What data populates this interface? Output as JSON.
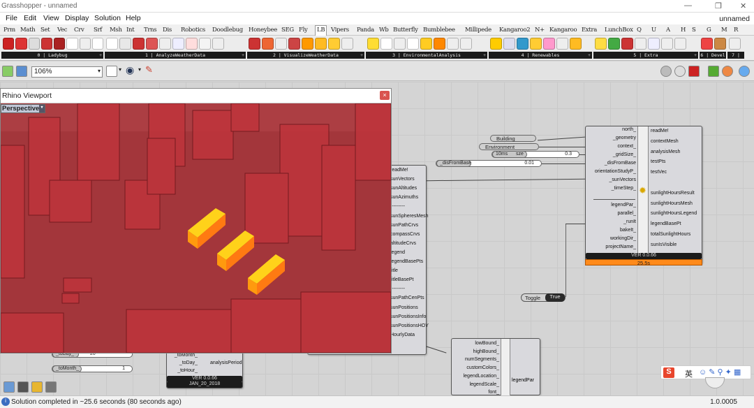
{
  "window": {
    "title": "Grasshopper - unnamed",
    "doc_name": "unnamed"
  },
  "menu": [
    "File",
    "Edit",
    "View",
    "Display",
    "Solution",
    "Help"
  ],
  "tabs": [
    "Prm",
    "Math",
    "Set",
    "Vec",
    "Crv",
    "Srf",
    "Msh",
    "Int",
    "Trns",
    "Dis",
    "Robotics",
    "Doodlebug",
    "Honeybee",
    "SEG",
    "Fly",
    "LB",
    "Vipers",
    "Panda",
    "Wb",
    "Butterfly",
    "Bumblebee",
    "Millipede",
    "Kangaroo2",
    "N+",
    "Kangaroo",
    "Extra",
    "LunchBox",
    "Q",
    "U",
    "A",
    "H",
    "S",
    "G",
    "M",
    "R"
  ],
  "active_tab": "LB",
  "ribbon_groups": [
    "0 | Ladybug",
    "1 | AnalyzeWeatherData",
    "2 | VisualizeWeatherData",
    "3 | EnvironmentalAnalysis",
    "4 | Renewables",
    "5 | Extra",
    "6 | Devel",
    "7 |"
  ],
  "toolbar": {
    "zoom": "106%"
  },
  "rhino": {
    "title": "Rhino Viewport",
    "view": "Perspective",
    "close": "×"
  },
  "sunlight_comp": {
    "inputs": [
      "north_",
      "_geometry",
      "context_",
      "_gridSize_",
      "_disFromBase",
      "orientationStudyP_",
      "_sunVectors",
      "_timeStep_",
      "",
      "legendPar_",
      "parallel_",
      "_runIt",
      "bakeIt_",
      "workingDir_",
      "projectName_"
    ],
    "outputs": [
      "readMe!",
      "contextMesh",
      "analysisMesh",
      "testPts",
      "testVec",
      "",
      "sunlightHoursResult",
      "sunlightHoursMesh",
      "sunlightHoursLegend",
      "legendBasePt",
      "totalSunlightHours",
      "sunIsVisible"
    ],
    "version": "VER 0.0.66",
    "time": "25.5s"
  },
  "sunpath_outputs": [
    "readMe!",
    "sunVectors",
    "sunAltitudes",
    "sunAzimuths",
    "---------",
    "sunSpheresMesh",
    "sunPathCrvs",
    "compassCrvs",
    "altitudeCrvs",
    "legend",
    "legendBasePts",
    "title",
    "titleBasePt",
    "---------",
    "sunPathCenPts",
    "sunPositions",
    "sunPositionsInfo",
    "sunPositionsHOY",
    "HourlyData"
  ],
  "period_comp": {
    "inputs": [
      "_toMonth_",
      "_toDay_",
      "_toHour_"
    ],
    "output": "analysisPeriod",
    "version": "VER 0.0.66",
    "date": "JAN_20_2018"
  },
  "left_sliders": [
    {
      "label": "_toDay_",
      "value": "20"
    },
    {
      "label": "_toMonth_",
      "value": "1"
    }
  ],
  "legend_comp": {
    "inputs": [
      "lowBound_",
      "highBound_",
      "numSegments_",
      "customColors_",
      "legendLocation_",
      "legendScale_",
      "font_"
    ],
    "output": "legendPar"
  },
  "panels": {
    "building": "Building",
    "environment": "Environment"
  },
  "sliders": [
    {
      "label": "_gridSize",
      "value": "0.3",
      "tag": "10ms"
    },
    {
      "label": "_disFromBase",
      "value": "0.01"
    }
  ],
  "toggle": {
    "label": "Toggle",
    "value": "True"
  },
  "status": {
    "text": "Solution completed in ~25.6 seconds (80 seconds ago)",
    "version": "1.0.0005"
  },
  "ime": {
    "label": "英"
  }
}
